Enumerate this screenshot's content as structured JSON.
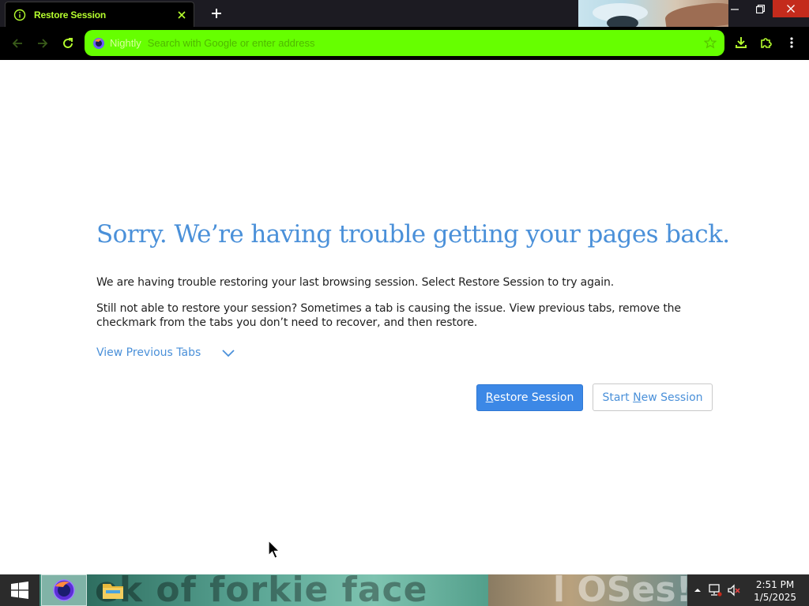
{
  "window": {
    "tab_title": "Restore Session",
    "tab_icon": "info-icon",
    "colors": {
      "tab_text": "#b6ff2e",
      "urlbar_bg": "#66ff00",
      "accent_blue": "#4a90d9",
      "primary_button": "#3c88e6"
    }
  },
  "navbar": {
    "brand": "Nightly",
    "placeholder": "Search with Google or enter address"
  },
  "content": {
    "title": "Sorry. We’re having trouble getting your pages back.",
    "para1": "We are having trouble restoring your last browsing session. Select Restore Session to try again.",
    "para2": "Still not able to restore your session? Sometimes a tab is causing the issue. View previous tabs, remove the checkmark from the tabs you don’t need to recover, and then restore.",
    "view_tabs": "View Previous Tabs",
    "restore_button": {
      "accel": "R",
      "rest": "estore Session"
    },
    "new_session_button": {
      "before": "Start ",
      "accel": "N",
      "after": "ew Session"
    }
  },
  "taskbar": {
    "wallpaper_text": "ek of forkie face",
    "wallpaper_text2": "l OSes!",
    "clock_time": "2:51 PM",
    "clock_date": "1/5/2025"
  }
}
